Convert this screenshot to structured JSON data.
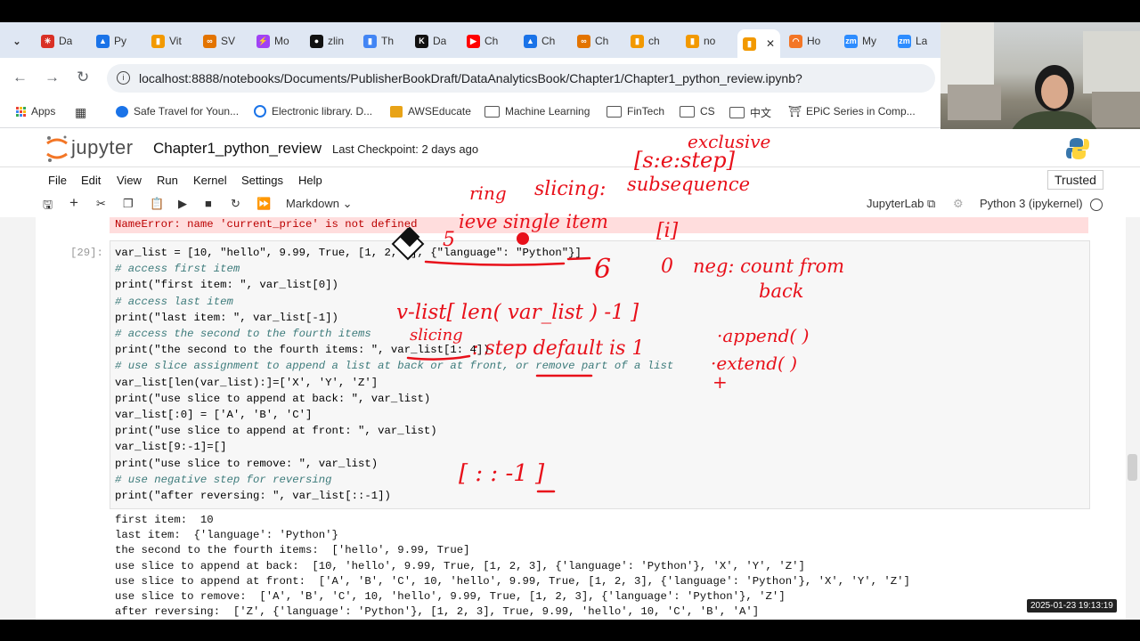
{
  "browser": {
    "tabs": [
      {
        "label": "Da",
        "color": "#d93025",
        "glyph": "✳"
      },
      {
        "label": "Py",
        "color": "#1a73e8",
        "glyph": "▲"
      },
      {
        "label": "Vit",
        "color": "#f29900",
        "glyph": "▮"
      },
      {
        "label": "SV",
        "color": "#e37400",
        "glyph": "∞"
      },
      {
        "label": "Mo",
        "color": "#a142f4",
        "glyph": "⚡"
      },
      {
        "label": "zlin",
        "color": "#111111",
        "glyph": "●"
      },
      {
        "label": "Th",
        "color": "#4285f4",
        "glyph": "▮"
      },
      {
        "label": "Da",
        "color": "#111111",
        "glyph": "K"
      },
      {
        "label": "Ch",
        "color": "#ff0000",
        "glyph": "▶"
      },
      {
        "label": "Ch",
        "color": "#1a73e8",
        "glyph": "▲"
      },
      {
        "label": "Ch",
        "color": "#e37400",
        "glyph": "∞"
      },
      {
        "label": "ch",
        "color": "#f29900",
        "glyph": "▮"
      },
      {
        "label": "no",
        "color": "#f29900",
        "glyph": "▮"
      },
      {
        "label": "",
        "color": "#f29900",
        "glyph": "▮",
        "active": true,
        "close": "✕"
      },
      {
        "label": "Ho",
        "color": "#f37626",
        "glyph": "◠"
      },
      {
        "label": "My",
        "color": "#2d8cff",
        "glyph": "zm"
      },
      {
        "label": "La",
        "color": "#2d8cff",
        "glyph": "zm"
      }
    ],
    "url": "localhost:8888/notebooks/Documents/PublisherBookDraft/DataAnalyticsBook/Chapter1/Chapter1_python_review.ipynb?",
    "bookmarks": [
      "Apps",
      "Safe Travel for Youn...",
      "Electronic library. D...",
      "AWSEducate",
      "Machine Learning",
      "FinTech",
      "CS",
      "中文",
      "EPiC Series in Comp..."
    ]
  },
  "jupyter": {
    "logo_text": "jupyter",
    "notebook_title": "Chapter1_python_review",
    "checkpoint": "Last Checkpoint: 2 days ago",
    "trusted": "Trusted",
    "menu": [
      "File",
      "Edit",
      "View",
      "Run",
      "Kernel",
      "Settings",
      "Help"
    ],
    "cell_type": "Markdown",
    "jupyterlab": "JupyterLab",
    "kernel": "Python 3 (ipykernel)"
  },
  "notebook": {
    "error": "NameError: name 'current_price' is not defined",
    "prompt": "[29]:",
    "code": [
      "var_list = [10, \"hello\", 9.99, True, [1, 2, 3], {\"language\": \"Python\"}]",
      "# access first item",
      "print(\"first item: \", var_list[0])",
      "# access last item",
      "print(\"last item: \", var_list[-1])",
      "# access the second to the fourth items",
      "print(\"the second to the fourth items: \", var_list[1: 4])",
      "# use slice assignment to append a list at back or at front, or remove part of a list",
      "var_list[len(var_list):]=['X', 'Y', 'Z']",
      "print(\"use slice to append at back: \", var_list)",
      "var_list[:0] = ['A', 'B', 'C']",
      "print(\"use slice to append at front: \", var_list)",
      "var_list[9:-1]=[]",
      "print(\"use slice to remove: \", var_list)",
      "# use negative step for reversing",
      "print(\"after reversing: \", var_list[::-1])"
    ],
    "output": [
      "first item:  10",
      "last item:  {'language': 'Python'}",
      "the second to the fourth items:  ['hello', 9.99, True]",
      "use slice to append at back:  [10, 'hello', 9.99, True, [1, 2, 3], {'language': 'Python'}, 'X', 'Y', 'Z']",
      "use slice to append at front:  ['A', 'B', 'C', 10, 'hello', 9.99, True, [1, 2, 3], {'language': 'Python'}, 'X', 'Y', 'Z']",
      "use slice to remove:  ['A', 'B', 'C', 10, 'hello', 9.99, True, [1, 2, 3], {'language': 'Python'}, 'Z']",
      "after reversing:  ['Z', {'language': 'Python'}, [1, 2, 3], True, 9.99, 'hello', 10, 'C', 'B', 'A']"
    ]
  },
  "annotations": {
    "exclusive": "exclusive",
    "bracket": "[s:e:step]",
    "slicing": "slicing:",
    "subsequence": "subsequence",
    "ring": "ring",
    "single_item": "ieve single item",
    "idx": "[i]",
    "s": "5",
    "six": "6",
    "zero": "0",
    "neg": "neg: count from",
    "back": "back",
    "len_expr": "v-list[ len( var_list ) -1 ]",
    "slicing2": "slicing",
    "step_default": ": step default is 1",
    "append": "·append( )",
    "extend": "·extend( )",
    "plus": "+",
    "reverse": "[ : : -1 ]"
  },
  "timestamp": "2025-01-23 19:13:19",
  "colors": {
    "ink": "#e8101a",
    "jupyter_orange": "#f37626",
    "error_bg": "#ffdddd"
  }
}
